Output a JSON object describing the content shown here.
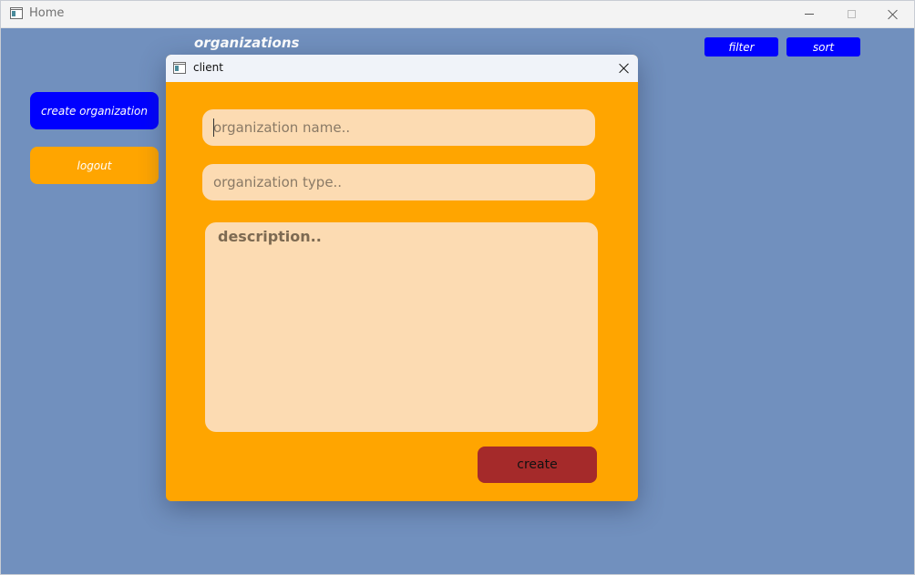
{
  "window": {
    "title": "Home"
  },
  "main": {
    "heading": "organizations",
    "filter_label": "filter",
    "sort_label": "sort",
    "create_org_label": "create organization",
    "logout_label": "logout"
  },
  "dialog": {
    "title": "client",
    "name_placeholder": "organization name..",
    "type_placeholder": "organization type..",
    "description_placeholder": "description..",
    "create_label": "create"
  },
  "colors": {
    "background": "#7190be",
    "primary_button": "#0000ff",
    "logout_button": "#ffa500",
    "dialog_background": "#ffa500",
    "field_background": "#fcdbb2",
    "create_button": "#a52a2a"
  },
  "icons": {
    "app": "app-window-icon",
    "minimize": "minimize-icon",
    "maximize": "maximize-icon",
    "close": "close-icon"
  }
}
